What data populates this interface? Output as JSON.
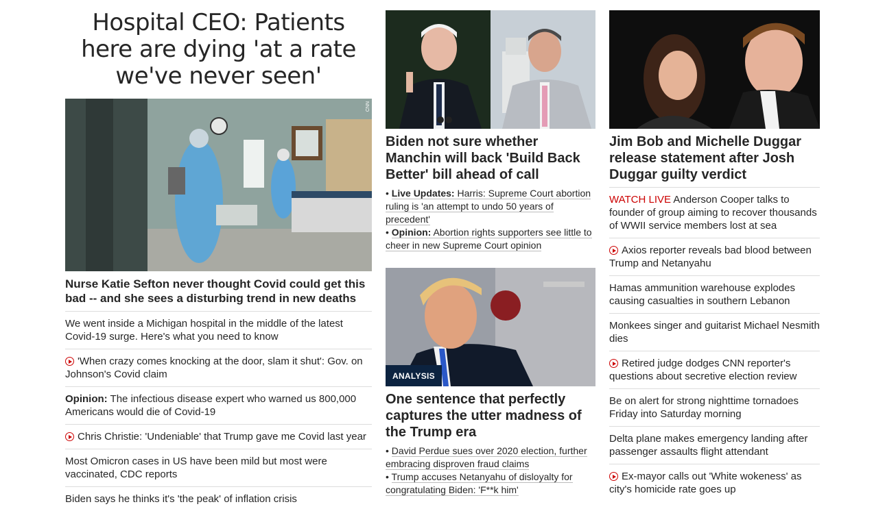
{
  "col1": {
    "headline": "Hospital CEO: Patients here are dying 'at a rate we've never seen'",
    "image_tag": "CNN",
    "lead_title": "Nurse Katie Sefton never thought Covid could get this bad -- and she sees a disturbing trend in new deaths",
    "stories": [
      {
        "text": "We went inside a Michigan hospital in the middle of the latest Covid-19 surge. Here's what you need to know"
      },
      {
        "video": true,
        "text": "'When crazy comes knocking at the door, slam it shut': Gov. on Johnson's Covid claim"
      },
      {
        "prefix": "Opinion:",
        "text": " The infectious disease expert who warned us 800,000 Americans would die of Covid-19"
      },
      {
        "video": true,
        "text": "Chris Christie: 'Undeniable' that Trump gave me Covid last year"
      },
      {
        "text": "Most Omicron cases in US have been mild but most were vaccinated, CDC reports"
      },
      {
        "text": "Biden says he thinks it's 'the peak' of inflation crisis"
      }
    ]
  },
  "col2": {
    "story1": {
      "title": "Biden not sure whether Manchin will back 'Build Back Better' bill ahead of call",
      "subs": [
        {
          "prefix": "Live Updates:",
          "text": " Harris: Supreme Court abortion ruling is 'an attempt to undo 50 years of precedent'"
        },
        {
          "prefix": "Opinion:",
          "text": " Abortion rights supporters see little to cheer in new Supreme Court opinion"
        }
      ]
    },
    "story2": {
      "badge": "ANALYSIS",
      "title": "One sentence that perfectly captures the utter madness of the Trump era",
      "subs": [
        {
          "text": "David Perdue sues over 2020 election, further embracing disproven fraud claims"
        },
        {
          "text": "Trump accuses Netanyahu of disloyalty for congratulating Biden: 'F**k him'"
        }
      ]
    }
  },
  "col3": {
    "title": "Jim Bob and Michelle Duggar release statement after Josh Duggar guilty verdict",
    "stories": [
      {
        "live": "WATCH LIVE",
        "text": " Anderson Cooper talks to founder of group aiming to recover thousands of WWII service members lost at sea"
      },
      {
        "video": true,
        "text": "Axios reporter reveals bad blood between Trump and Netanyahu"
      },
      {
        "text": "Hamas ammunition warehouse explodes causing casualties in southern Lebanon"
      },
      {
        "text": "Monkees singer and guitarist Michael Nesmith dies"
      },
      {
        "video": true,
        "text": "Retired judge dodges CNN reporter's questions about secretive election review"
      },
      {
        "text": "Be on alert for strong nighttime tornadoes Friday into Saturday morning"
      },
      {
        "text": "Delta plane makes emergency landing after passenger assaults flight attendant"
      },
      {
        "video": true,
        "text": "Ex-mayor calls out 'White wokeness' as city's homicide rate goes up"
      }
    ]
  },
  "colors": {
    "accent_red": "#cc0000",
    "text": "#262626",
    "divider": "#dcdcdc",
    "badge_bg": "#0c2340"
  }
}
